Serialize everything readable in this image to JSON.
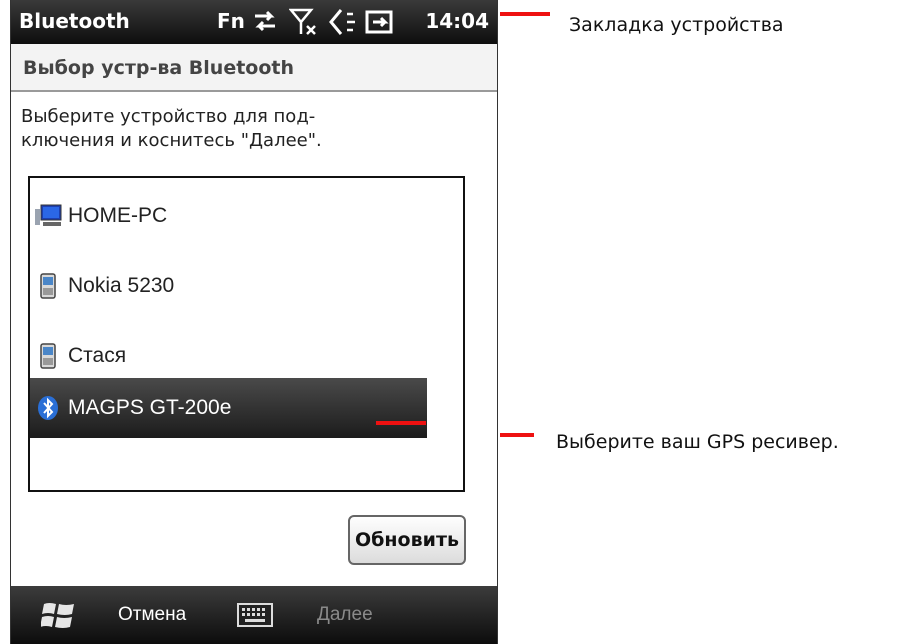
{
  "status_bar": {
    "title": "Bluetooth",
    "fn_label": "Fn",
    "time": "14:04",
    "icons": [
      "data-transfer-icon",
      "no-signal-icon",
      "speaker-muted-icon",
      "battery-charging-icon"
    ]
  },
  "header": {
    "title": "Выбор устр-ва Bluetooth"
  },
  "instructions": "Выберите устройство для под-\nключения и коснитесь \"Далее\".",
  "devices": [
    {
      "label": "HOME-PC",
      "icon": "computer-icon",
      "selected": false
    },
    {
      "label": "Nokia 5230",
      "icon": "phone-icon",
      "selected": false
    },
    {
      "label": "Стася",
      "icon": "phone-icon",
      "selected": false
    },
    {
      "label": "MAGPS GT-200e",
      "icon": "bluetooth-icon",
      "selected": true
    }
  ],
  "refresh_button": "Обновить",
  "bottom_bar": {
    "cancel": "Отмена",
    "next": "Далее",
    "start_icon": "windows-start-icon",
    "keyboard_icon": "keyboard-icon"
  },
  "annotations": {
    "tab": "Закладка устройства",
    "select_gps": "Выберите ваш GPS ресивер."
  },
  "colors": {
    "annotation_red": "#ee1111",
    "bar_dark": "#1a1a1a",
    "selection_dark": "#2a2a2a"
  }
}
